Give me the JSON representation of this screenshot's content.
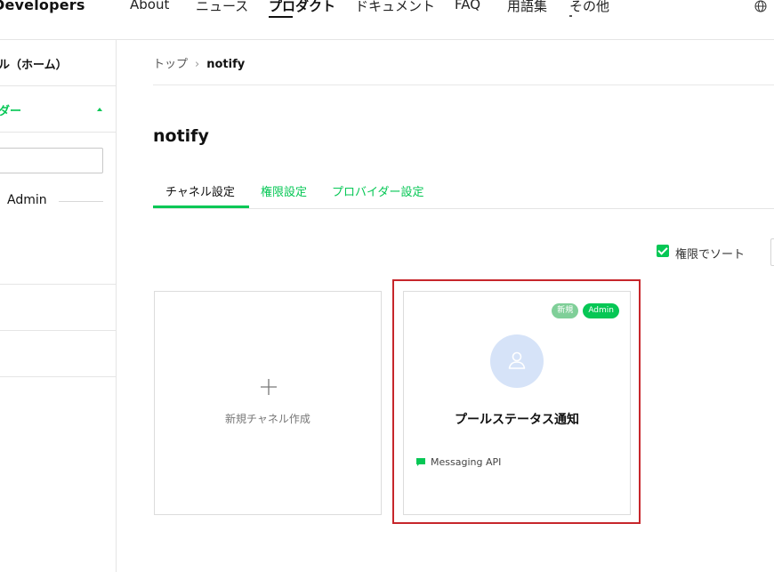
{
  "header": {
    "brand": "Developers",
    "nav": [
      {
        "label": "About",
        "active": false
      },
      {
        "label": "ニュース",
        "active": false
      },
      {
        "label": "プロダクト",
        "active": true
      },
      {
        "label": "ドキュメント",
        "active": false
      },
      {
        "label": "FAQ",
        "active": false
      },
      {
        "label": "用語集",
        "active": false
      },
      {
        "label": "その他",
        "active": false
      }
    ],
    "language_icon": "globe-icon"
  },
  "sidebar": {
    "home_label": "ル（ホーム）",
    "provider_label": "ダー",
    "search_value": "",
    "admin_label": "Admin"
  },
  "breadcrumb": {
    "top": "トップ",
    "current": "notify"
  },
  "page": {
    "title": "notify"
  },
  "tabs": [
    {
      "label": "チャネル設定",
      "active": true
    },
    {
      "label": "権限設定",
      "active": false
    },
    {
      "label": "プロバイダー設定",
      "active": false
    }
  ],
  "sort": {
    "label": "権限でソート",
    "checked": true
  },
  "cards": {
    "new_channel_label": "新規チャネル作成",
    "channel": {
      "name": "プールステータス通知",
      "badge_new": "新規",
      "badge_admin": "Admin",
      "type_label": "Messaging API"
    }
  },
  "colors": {
    "accent": "#06c755",
    "highlight": "#c7262b",
    "avatar_bg": "#d6e3f8"
  }
}
